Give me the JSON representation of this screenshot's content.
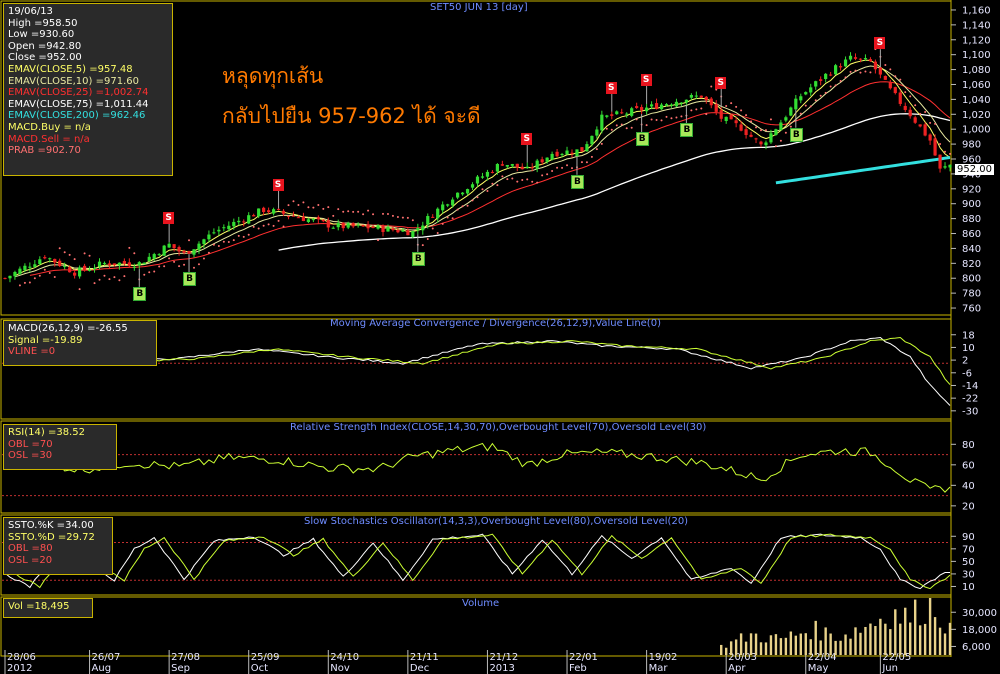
{
  "colors": {
    "bg": "#000000",
    "panel_border": "#c9b400",
    "candle_up": "#33dd33",
    "candle_down": "#ee2222",
    "ema5": "#ffff66",
    "ema10": "#e8e8a0",
    "ema25": "#ff3030",
    "ema75": "#ffffff",
    "ema200": "#33e0e0",
    "sar": "#ff7070",
    "osc1": "#ffffff",
    "osc2": "#ccff33",
    "refline": "#c03030",
    "volume": "#e8d28a"
  },
  "header_title": "SET50 JUN 13   [day]",
  "annotation": {
    "line1": "หลุดทุกเส้น",
    "line2": "กลับไปยืน 957-962 ได้ จะดี"
  },
  "price_panel": {
    "lines": [
      {
        "text": "19/06/13",
        "color": "#ffffff"
      },
      {
        "text": "High   =958.50",
        "color": "#ffffff"
      },
      {
        "text": "Low   =930.60",
        "color": "#ffffff"
      },
      {
        "text": "Open   =942.80",
        "color": "#ffffff"
      },
      {
        "text": "Close   =952.00",
        "color": "#ffffff"
      },
      {
        "text": "EMAV(CLOSE,5)    =957.48",
        "color": "#ffff66"
      },
      {
        "text": "EMAV(CLOSE,10)    =971.60",
        "color": "#e8e8a0"
      },
      {
        "text": "EMAV(CLOSE,25)    =1,002.74",
        "color": "#ff3030"
      },
      {
        "text": "EMAV(CLOSE,75)    =1,011.44",
        "color": "#ffffff"
      },
      {
        "text": "EMAV(CLOSE,200)    =962.46",
        "color": "#33e0e0"
      },
      {
        "text": "MACD.Buy    = n/a",
        "color": "#ffff66"
      },
      {
        "text": "MACD.Sell    = n/a",
        "color": "#ff3030"
      },
      {
        "text": "PRAB   =902.70",
        "color": "#ff7070"
      }
    ]
  },
  "macd_panel": {
    "title": "Moving Average Convergence / Divergence(26,12,9),Value Line(0)",
    "lines": [
      {
        "text": "MACD(26,12,9)   =-26.55",
        "color": "#ffffff"
      },
      {
        "text": "Signal   =-19.89",
        "color": "#ffff66"
      },
      {
        "text": "VLINE   =0",
        "color": "#ff5050"
      }
    ]
  },
  "rsi_panel": {
    "title": "Relative Strength Index(CLOSE,14,30,70),Overbought Level(70),Oversold Level(30)",
    "lines": [
      {
        "text": "RSI(14)   =38.52",
        "color": "#ffff66"
      },
      {
        "text": "OBL   =70",
        "color": "#ff5050"
      },
      {
        "text": "OSL   =30",
        "color": "#ff5050"
      }
    ]
  },
  "stoch_panel": {
    "title": "Slow Stochastics Oscillator(14,3,3),Overbought Level(80),Oversold Level(20)",
    "lines": [
      {
        "text": "SSTO.%K   =34.00",
        "color": "#ffffff"
      },
      {
        "text": "SSTO.%D   =29.72",
        "color": "#ffff66"
      },
      {
        "text": "OBL   =80",
        "color": "#ff5050"
      },
      {
        "text": "OSL   =20",
        "color": "#ff5050"
      }
    ]
  },
  "vol_panel": {
    "title": "Volume",
    "lines": [
      {
        "text": "Vol   =18,495",
        "color": "#ffff66"
      }
    ]
  },
  "last_price_box": "952.00",
  "signals": [
    {
      "t": "B",
      "i": 27
    },
    {
      "t": "S",
      "i": 33
    },
    {
      "t": "B",
      "i": 37
    },
    {
      "t": "S",
      "i": 55
    },
    {
      "t": "B",
      "i": 83
    },
    {
      "t": "S",
      "i": 105
    },
    {
      "t": "B",
      "i": 115
    },
    {
      "t": "S",
      "i": 122
    },
    {
      "t": "B",
      "i": 128
    },
    {
      "t": "S",
      "i": 129
    },
    {
      "t": "B",
      "i": 137
    },
    {
      "t": "S",
      "i": 144
    },
    {
      "t": "B",
      "i": 159
    },
    {
      "t": "S",
      "i": 176
    }
  ],
  "chart_data": {
    "type": "candlestick",
    "title": "SET50 JUN 13 [day]",
    "y_ticks": [
      1160,
      1140,
      1120,
      1100,
      1080,
      1060,
      1040,
      1020,
      1000,
      980,
      960,
      940,
      920,
      900,
      880,
      860,
      840,
      820,
      800,
      780,
      760
    ],
    "ylim": [
      752,
      1168
    ],
    "date_ticks": [
      {
        "top": "28/06",
        "bottom": "2012",
        "i": 0
      },
      {
        "top": "26/07",
        "bottom": "Aug",
        "i": 17
      },
      {
        "top": "27/08",
        "bottom": "Sep",
        "i": 33
      },
      {
        "top": "25/09",
        "bottom": "Oct",
        "i": 49
      },
      {
        "top": "24/10",
        "bottom": "Nov",
        "i": 65
      },
      {
        "top": "21/11",
        "bottom": "Dec",
        "i": 81
      },
      {
        "top": "21/12",
        "bottom": "2013",
        "i": 97
      },
      {
        "top": "22/01",
        "bottom": "Feb",
        "i": 113
      },
      {
        "top": "19/02",
        "bottom": "Mar",
        "i": 129
      },
      {
        "top": "20/03",
        "bottom": "Apr",
        "i": 145
      },
      {
        "top": "22/04",
        "bottom": "May",
        "i": 161
      },
      {
        "top": "22/05",
        "bottom": "Jun",
        "i": 176
      }
    ],
    "close_anchors": [
      [
        0,
        800
      ],
      [
        8,
        830
      ],
      [
        14,
        808
      ],
      [
        20,
        820
      ],
      [
        27,
        820
      ],
      [
        33,
        845
      ],
      [
        36,
        832
      ],
      [
        42,
        862
      ],
      [
        52,
        892
      ],
      [
        58,
        884
      ],
      [
        66,
        870
      ],
      [
        74,
        868
      ],
      [
        82,
        862
      ],
      [
        90,
        910
      ],
      [
        100,
        955
      ],
      [
        105,
        945
      ],
      [
        110,
        968
      ],
      [
        116,
        972
      ],
      [
        120,
        1015
      ],
      [
        125,
        1022
      ],
      [
        130,
        1030
      ],
      [
        136,
        1040
      ],
      [
        140,
        1045
      ],
      [
        144,
        1015
      ],
      [
        148,
        1002
      ],
      [
        152,
        978
      ],
      [
        156,
        1010
      ],
      [
        160,
        1045
      ],
      [
        166,
        1078
      ],
      [
        170,
        1095
      ],
      [
        174,
        1090
      ],
      [
        178,
        1052
      ],
      [
        182,
        1020
      ],
      [
        186,
        985
      ],
      [
        188,
        945
      ],
      [
        190,
        952
      ]
    ],
    "ema75_start": 55,
    "ema200_start": 155,
    "macd": {
      "ticks": [
        18,
        10,
        2,
        -6,
        -14,
        -22,
        -30
      ],
      "ylim": [
        -32,
        21
      ],
      "anchors": [
        [
          0,
          -1
        ],
        [
          10,
          4
        ],
        [
          20,
          1
        ],
        [
          35,
          3
        ],
        [
          50,
          9
        ],
        [
          65,
          4
        ],
        [
          80,
          0
        ],
        [
          95,
          12
        ],
        [
          110,
          14
        ],
        [
          120,
          11
        ],
        [
          135,
          9
        ],
        [
          150,
          -3
        ],
        [
          160,
          3
        ],
        [
          170,
          14
        ],
        [
          176,
          16
        ],
        [
          182,
          4
        ],
        [
          186,
          -14
        ],
        [
          190,
          -26.5
        ]
      ]
    },
    "rsi": {
      "ticks": [
        80,
        60,
        40,
        20
      ],
      "ylim": [
        14,
        92
      ],
      "ob": 70,
      "os": 30,
      "anchors": [
        [
          0,
          58
        ],
        [
          8,
          62
        ],
        [
          15,
          55
        ],
        [
          25,
          62
        ],
        [
          35,
          58
        ],
        [
          45,
          67
        ],
        [
          55,
          65
        ],
        [
          65,
          57
        ],
        [
          75,
          56
        ],
        [
          82,
          68
        ],
        [
          90,
          74
        ],
        [
          98,
          78
        ],
        [
          105,
          60
        ],
        [
          112,
          70
        ],
        [
          120,
          72
        ],
        [
          130,
          68
        ],
        [
          140,
          62
        ],
        [
          148,
          52
        ],
        [
          152,
          46
        ],
        [
          160,
          70
        ],
        [
          168,
          74
        ],
        [
          174,
          72
        ],
        [
          178,
          60
        ],
        [
          182,
          45
        ],
        [
          186,
          35
        ],
        [
          190,
          38.5
        ]
      ]
    },
    "stoch": {
      "ticks": [
        90,
        70,
        50,
        30,
        10
      ],
      "ylim": [
        -2,
        100
      ],
      "ob": 80,
      "os": 20,
      "anchors": [
        [
          0,
          30
        ],
        [
          5,
          10
        ],
        [
          10,
          55
        ],
        [
          14,
          85
        ],
        [
          18,
          40
        ],
        [
          22,
          20
        ],
        [
          26,
          70
        ],
        [
          30,
          88
        ],
        [
          36,
          22
        ],
        [
          42,
          82
        ],
        [
          50,
          90
        ],
        [
          56,
          60
        ],
        [
          62,
          85
        ],
        [
          68,
          25
        ],
        [
          74,
          80
        ],
        [
          80,
          20
        ],
        [
          86,
          85
        ],
        [
          96,
          92
        ],
        [
          102,
          30
        ],
        [
          108,
          85
        ],
        [
          114,
          30
        ],
        [
          120,
          90
        ],
        [
          126,
          55
        ],
        [
          132,
          88
        ],
        [
          138,
          20
        ],
        [
          146,
          40
        ],
        [
          150,
          15
        ],
        [
          156,
          88
        ],
        [
          164,
          92
        ],
        [
          172,
          88
        ],
        [
          176,
          70
        ],
        [
          180,
          20
        ],
        [
          184,
          8
        ],
        [
          188,
          28
        ],
        [
          190,
          34
        ]
      ]
    },
    "volume": {
      "ticks": [
        30000,
        18000,
        6000
      ],
      "ylim": [
        0,
        40000
      ],
      "start_i": 144,
      "anchors": [
        [
          144,
          6000
        ],
        [
          150,
          14000
        ],
        [
          156,
          11000
        ],
        [
          162,
          18000
        ],
        [
          168,
          13000
        ],
        [
          174,
          22000
        ],
        [
          178,
          30000
        ],
        [
          182,
          26000
        ],
        [
          186,
          38000
        ],
        [
          190,
          18495
        ]
      ]
    }
  }
}
